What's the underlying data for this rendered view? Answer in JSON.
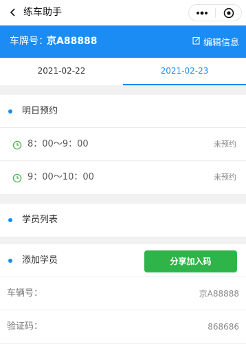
{
  "nav": {
    "title": "练车助手",
    "back_icon": "chevron-left-icon",
    "more_icon": "more-dots-icon",
    "close_icon": "target-circle-icon"
  },
  "header": {
    "plate_label": "车牌号：",
    "plate_value": "京A88888",
    "edit_label": "编辑信息",
    "edit_icon": "edit-icon"
  },
  "tabs": [
    {
      "label": "2021-02-22",
      "active": false
    },
    {
      "label": "2021-02-23",
      "active": true
    }
  ],
  "appointments": {
    "title": "明日预约",
    "slots": [
      {
        "time": "8：00～9：00",
        "status": "未预约"
      },
      {
        "time": "9：00～10：00",
        "status": "未预约"
      }
    ]
  },
  "students": {
    "title": "学员列表"
  },
  "add_student": {
    "title": "添加学员",
    "share_button": "分享加入码",
    "vehicle_label": "车辆号：",
    "vehicle_value": "京A88888",
    "code_label": "验证码：",
    "code_value": "868686"
  },
  "colors": {
    "primary": "#1a8cf3",
    "share_button": "#2fb44a",
    "clock_icon": "#4caf50",
    "background": "#f1f1f1"
  }
}
